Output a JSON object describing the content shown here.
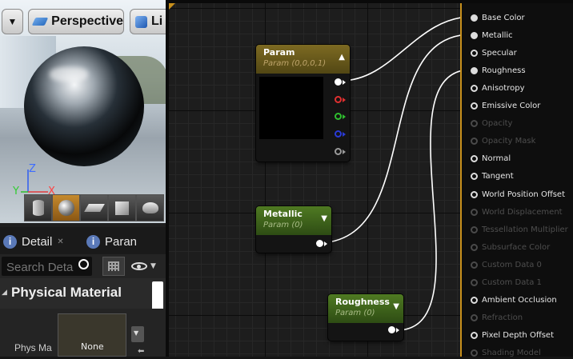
{
  "viewport": {
    "view_mode_label": "Perspective",
    "lit_label": "Li",
    "axis_x": "X",
    "axis_y": "Y",
    "axis_z": "Z"
  },
  "details": {
    "tab_details": "Detail",
    "tab_params": "Paran",
    "search_placeholder": "Search Detai",
    "category_title": "Physical Material",
    "prop_label": "Phys Ma",
    "prop_value": "None"
  },
  "nodes": {
    "param": {
      "title": "Param",
      "subtitle": "Param (0,0,0,1)",
      "pin_colors": [
        "#e03030",
        "#2fbf2f",
        "#2a3bd8",
        "#9a9a9a"
      ]
    },
    "metallic": {
      "title": "Metallic",
      "subtitle": "Param (0)"
    },
    "roughness": {
      "title": "Roughness",
      "subtitle": "Param (0)"
    }
  },
  "result_pins": [
    {
      "label": "Base Color",
      "enabled": true,
      "connected": true
    },
    {
      "label": "Metallic",
      "enabled": true,
      "connected": true
    },
    {
      "label": "Specular",
      "enabled": true,
      "connected": false
    },
    {
      "label": "Roughness",
      "enabled": true,
      "connected": true
    },
    {
      "label": "Anisotropy",
      "enabled": true,
      "connected": false
    },
    {
      "label": "Emissive Color",
      "enabled": true,
      "connected": false
    },
    {
      "label": "Opacity",
      "enabled": false,
      "connected": false
    },
    {
      "label": "Opacity Mask",
      "enabled": false,
      "connected": false
    },
    {
      "label": "Normal",
      "enabled": true,
      "connected": false
    },
    {
      "label": "Tangent",
      "enabled": true,
      "connected": false
    },
    {
      "label": "World Position Offset",
      "enabled": true,
      "connected": false
    },
    {
      "label": "World Displacement",
      "enabled": false,
      "connected": false
    },
    {
      "label": "Tessellation Multiplier",
      "enabled": false,
      "connected": false
    },
    {
      "label": "Subsurface Color",
      "enabled": false,
      "connected": false
    },
    {
      "label": "Custom Data 0",
      "enabled": false,
      "connected": false
    },
    {
      "label": "Custom Data 1",
      "enabled": false,
      "connected": false
    },
    {
      "label": "Ambient Occlusion",
      "enabled": true,
      "connected": false
    },
    {
      "label": "Refraction",
      "enabled": false,
      "connected": false
    },
    {
      "label": "Pixel Depth Offset",
      "enabled": true,
      "connected": false
    },
    {
      "label": "Shading Model",
      "enabled": false,
      "connected": false
    }
  ],
  "colors": {
    "param_header": "#7d6a22",
    "scalar_header": "#4f7a22",
    "result_border": "#c8901c",
    "pin_enabled": "#dddddd",
    "pin_disabled": "#4a4a4a"
  }
}
